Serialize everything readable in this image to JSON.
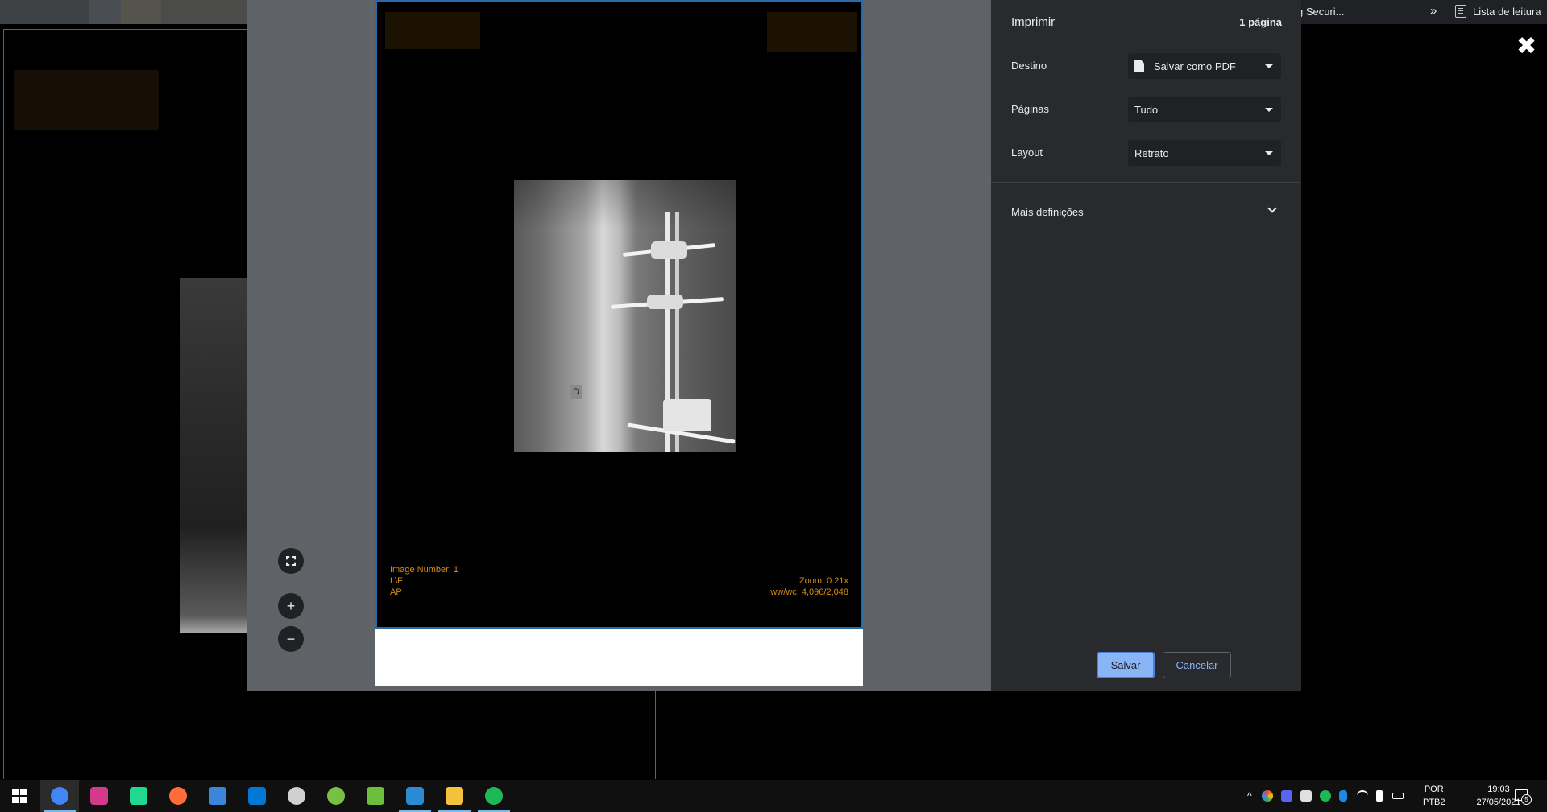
{
  "background": {
    "topbar_tab_fragment": "g Securi...",
    "reading_list": "Lista de leitura",
    "overflow_chevron": "»",
    "close_glyph": "✖"
  },
  "preview": {
    "overlay_left": [
      "Image Number: 1",
      "L\\F",
      "AP"
    ],
    "overlay_right": [
      "Zoom: 0.21x",
      "ww/wc: 4,096/2,048"
    ],
    "marker": "D"
  },
  "print_dialog": {
    "title": "Imprimir",
    "page_count": "1 página",
    "destination": {
      "label": "Destino",
      "value": "Salvar como PDF"
    },
    "pages": {
      "label": "Páginas",
      "value": "Tudo"
    },
    "layout": {
      "label": "Layout",
      "value": "Retrato"
    },
    "more_settings": "Mais definições",
    "save_button": "Salvar",
    "cancel_button": "Cancelar"
  },
  "taskbar": {
    "apps": [
      {
        "name": "chrome-icon",
        "color": "#4285f4",
        "active": true
      },
      {
        "name": "intellij-icon",
        "color": "#d33a8b",
        "active": false
      },
      {
        "name": "datagrip-icon",
        "color": "#22d88f",
        "active": false
      },
      {
        "name": "postman-icon",
        "color": "#ff6c37",
        "active": false
      },
      {
        "name": "remote-desktop-icon",
        "color": "#3a86d8",
        "active": false
      },
      {
        "name": "ms-store-icon",
        "color": "#0078d4",
        "active": false
      },
      {
        "name": "obs-icon",
        "color": "#d0d0d0",
        "active": false
      },
      {
        "name": "utorrent-icon",
        "color": "#78c043",
        "active": false
      },
      {
        "name": "anydesk-icon",
        "color": "#6cbf3c",
        "active": false
      },
      {
        "name": "vscode-icon",
        "color": "#2a8ad4",
        "active": true
      },
      {
        "name": "file-explorer-icon",
        "color": "#f3c13a",
        "active": true
      },
      {
        "name": "spotify-icon",
        "color": "#1db954",
        "active": true
      }
    ],
    "lang_line1": "POR",
    "lang_line2": "PTB2",
    "time": "19:03",
    "date": "27/05/2021",
    "notification_count": "5",
    "tray_chevron": "^"
  }
}
